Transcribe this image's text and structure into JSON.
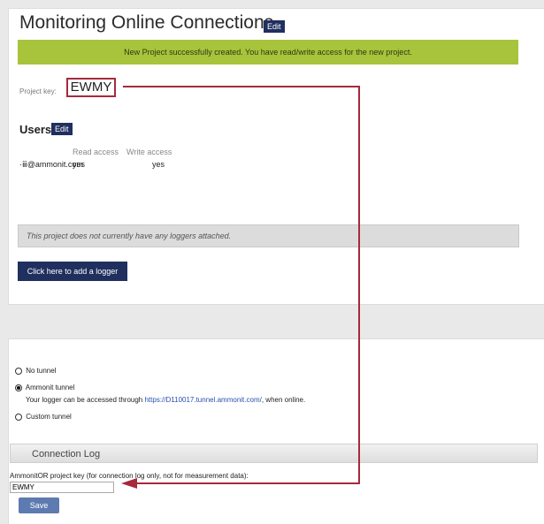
{
  "project": {
    "title": "Monitoring Online Connections",
    "edit_label": "Edit",
    "success_message": "New Project successfully created. You have read/write access for the new project.",
    "key_label": "Project key:",
    "key_value": "EWMY"
  },
  "users": {
    "heading": "Users",
    "edit_label": "Edit",
    "columns": [
      "Read access",
      "Write access"
    ],
    "rows": [
      {
        "email": "·ⅲ@ammonit.com",
        "read": "yes",
        "write": "yes"
      }
    ]
  },
  "loggers": {
    "empty_notice": "This project does not currently have any loggers attached.",
    "add_button": "Click here to add a logger"
  },
  "tunnel": {
    "options": [
      {
        "label": "No tunnel",
        "checked": false
      },
      {
        "label": "Ammonit tunnel",
        "checked": true
      },
      {
        "label": "Custom tunnel",
        "checked": false
      }
    ],
    "desc_prefix": "Your logger can be accessed through ",
    "desc_link": "https://D110017.tunnel.ammonit.com/",
    "desc_suffix": ", when online."
  },
  "connection_log": {
    "header": "Connection Log",
    "key_label": "AmmonitOR project key (for connection log only, not for measurement data):",
    "key_value": "EWMY",
    "save_label": "Save"
  },
  "colors": {
    "accent_dark": "#1f2f5e",
    "banner_green": "#a8c33c",
    "highlight_red": "#a52a3c",
    "save_blue": "#5d7bb0"
  }
}
